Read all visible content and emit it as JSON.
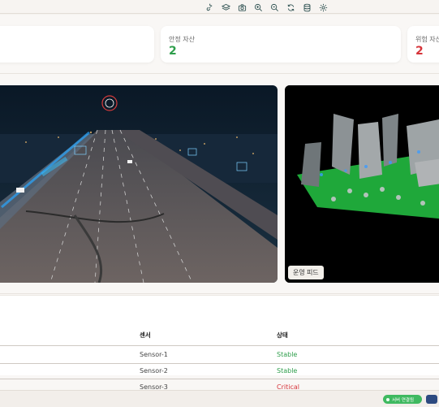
{
  "toolbar": {
    "icons": [
      "link-icon",
      "layers-icon",
      "camera-icon",
      "zoom-in-icon",
      "zoom-out-icon",
      "refresh-icon",
      "database-icon",
      "settings-icon"
    ]
  },
  "cards": [
    {
      "label": "",
      "value": ""
    },
    {
      "label": "안정 자산",
      "value": "2",
      "color": "#2e9e4b"
    },
    {
      "label": "위험 자산",
      "value": "2",
      "color": "#d6343a"
    }
  ],
  "feeds": {
    "operations_button": "운영 피드"
  },
  "table": {
    "headers": [
      "센서",
      "상태"
    ],
    "rows": [
      {
        "sensor": "Sensor-1",
        "status": "Stable",
        "status_color": "#2e9e4b"
      },
      {
        "sensor": "Sensor-2",
        "status": "Stable",
        "status_color": "#2e9e4b"
      },
      {
        "sensor": "Sensor-3",
        "status": "Critical",
        "status_color": "#d6343a"
      }
    ]
  },
  "statusbar": {
    "connection": "서버 연결됨"
  }
}
